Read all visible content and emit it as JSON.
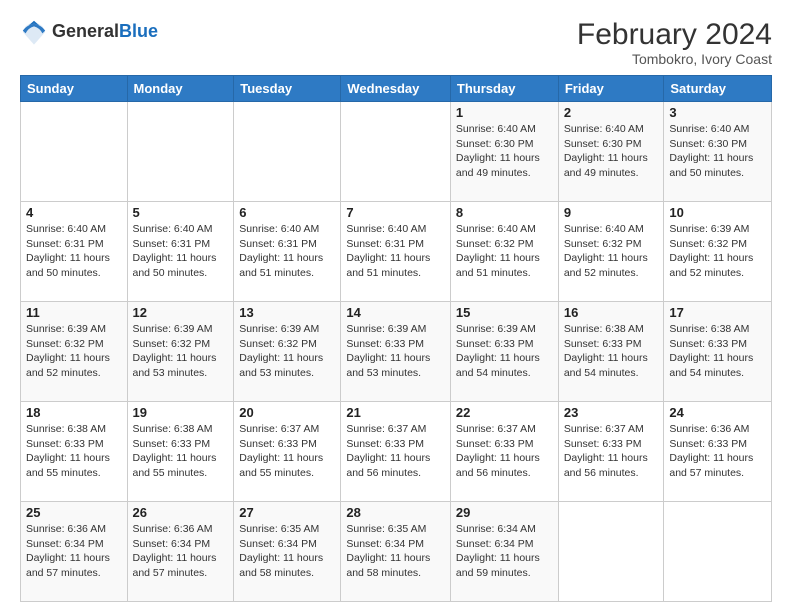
{
  "logo": {
    "general": "General",
    "blue": "Blue"
  },
  "header": {
    "month_year": "February 2024",
    "location": "Tombokro, Ivory Coast"
  },
  "days_of_week": [
    "Sunday",
    "Monday",
    "Tuesday",
    "Wednesday",
    "Thursday",
    "Friday",
    "Saturday"
  ],
  "weeks": [
    [
      {
        "day": "",
        "info": ""
      },
      {
        "day": "",
        "info": ""
      },
      {
        "day": "",
        "info": ""
      },
      {
        "day": "",
        "info": ""
      },
      {
        "day": "1",
        "info": "Sunrise: 6:40 AM\nSunset: 6:30 PM\nDaylight: 11 hours and 49 minutes."
      },
      {
        "day": "2",
        "info": "Sunrise: 6:40 AM\nSunset: 6:30 PM\nDaylight: 11 hours and 49 minutes."
      },
      {
        "day": "3",
        "info": "Sunrise: 6:40 AM\nSunset: 6:30 PM\nDaylight: 11 hours and 50 minutes."
      }
    ],
    [
      {
        "day": "4",
        "info": "Sunrise: 6:40 AM\nSunset: 6:31 PM\nDaylight: 11 hours and 50 minutes."
      },
      {
        "day": "5",
        "info": "Sunrise: 6:40 AM\nSunset: 6:31 PM\nDaylight: 11 hours and 50 minutes."
      },
      {
        "day": "6",
        "info": "Sunrise: 6:40 AM\nSunset: 6:31 PM\nDaylight: 11 hours and 51 minutes."
      },
      {
        "day": "7",
        "info": "Sunrise: 6:40 AM\nSunset: 6:31 PM\nDaylight: 11 hours and 51 minutes."
      },
      {
        "day": "8",
        "info": "Sunrise: 6:40 AM\nSunset: 6:32 PM\nDaylight: 11 hours and 51 minutes."
      },
      {
        "day": "9",
        "info": "Sunrise: 6:40 AM\nSunset: 6:32 PM\nDaylight: 11 hours and 52 minutes."
      },
      {
        "day": "10",
        "info": "Sunrise: 6:39 AM\nSunset: 6:32 PM\nDaylight: 11 hours and 52 minutes."
      }
    ],
    [
      {
        "day": "11",
        "info": "Sunrise: 6:39 AM\nSunset: 6:32 PM\nDaylight: 11 hours and 52 minutes."
      },
      {
        "day": "12",
        "info": "Sunrise: 6:39 AM\nSunset: 6:32 PM\nDaylight: 11 hours and 53 minutes."
      },
      {
        "day": "13",
        "info": "Sunrise: 6:39 AM\nSunset: 6:32 PM\nDaylight: 11 hours and 53 minutes."
      },
      {
        "day": "14",
        "info": "Sunrise: 6:39 AM\nSunset: 6:33 PM\nDaylight: 11 hours and 53 minutes."
      },
      {
        "day": "15",
        "info": "Sunrise: 6:39 AM\nSunset: 6:33 PM\nDaylight: 11 hours and 54 minutes."
      },
      {
        "day": "16",
        "info": "Sunrise: 6:38 AM\nSunset: 6:33 PM\nDaylight: 11 hours and 54 minutes."
      },
      {
        "day": "17",
        "info": "Sunrise: 6:38 AM\nSunset: 6:33 PM\nDaylight: 11 hours and 54 minutes."
      }
    ],
    [
      {
        "day": "18",
        "info": "Sunrise: 6:38 AM\nSunset: 6:33 PM\nDaylight: 11 hours and 55 minutes."
      },
      {
        "day": "19",
        "info": "Sunrise: 6:38 AM\nSunset: 6:33 PM\nDaylight: 11 hours and 55 minutes."
      },
      {
        "day": "20",
        "info": "Sunrise: 6:37 AM\nSunset: 6:33 PM\nDaylight: 11 hours and 55 minutes."
      },
      {
        "day": "21",
        "info": "Sunrise: 6:37 AM\nSunset: 6:33 PM\nDaylight: 11 hours and 56 minutes."
      },
      {
        "day": "22",
        "info": "Sunrise: 6:37 AM\nSunset: 6:33 PM\nDaylight: 11 hours and 56 minutes."
      },
      {
        "day": "23",
        "info": "Sunrise: 6:37 AM\nSunset: 6:33 PM\nDaylight: 11 hours and 56 minutes."
      },
      {
        "day": "24",
        "info": "Sunrise: 6:36 AM\nSunset: 6:33 PM\nDaylight: 11 hours and 57 minutes."
      }
    ],
    [
      {
        "day": "25",
        "info": "Sunrise: 6:36 AM\nSunset: 6:34 PM\nDaylight: 11 hours and 57 minutes."
      },
      {
        "day": "26",
        "info": "Sunrise: 6:36 AM\nSunset: 6:34 PM\nDaylight: 11 hours and 57 minutes."
      },
      {
        "day": "27",
        "info": "Sunrise: 6:35 AM\nSunset: 6:34 PM\nDaylight: 11 hours and 58 minutes."
      },
      {
        "day": "28",
        "info": "Sunrise: 6:35 AM\nSunset: 6:34 PM\nDaylight: 11 hours and 58 minutes."
      },
      {
        "day": "29",
        "info": "Sunrise: 6:34 AM\nSunset: 6:34 PM\nDaylight: 11 hours and 59 minutes."
      },
      {
        "day": "",
        "info": ""
      },
      {
        "day": "",
        "info": ""
      }
    ]
  ]
}
